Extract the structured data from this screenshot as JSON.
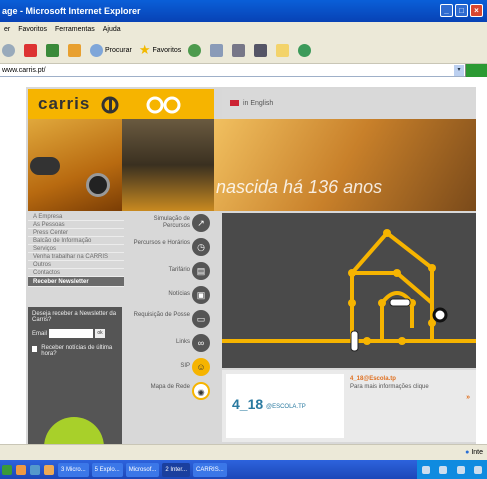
{
  "window": {
    "title": "age - Microsoft Internet Explorer"
  },
  "menubar": [
    "er",
    "Favoritos",
    "Ferramentas",
    "Ajuda"
  ],
  "toolbar": {
    "search": "Procurar",
    "favorites": "Favoritos"
  },
  "address": {
    "url": "www.carris.pt/"
  },
  "page": {
    "logo": "carris",
    "language_link": "in English",
    "tagline": "nascida há 136 anos",
    "menu": [
      "A Empresa",
      "As Pessoas",
      "Press Center",
      "Balcão de Informação",
      "Serviços",
      "Venha trabalhar na CARRIS",
      "Outros",
      "Contactos",
      "Receber Newsletter"
    ],
    "newsletter": {
      "prompt": "Deseja receber a Newsletter da Carris?",
      "email_label": "Email",
      "ok": "ok",
      "checkbox_label": "Receber notícias de última hora?"
    },
    "services": [
      {
        "label": "Simulação de Percursos",
        "icon": "route-icon"
      },
      {
        "label": "Percursos e Horários",
        "icon": "clock-icon"
      },
      {
        "label": "Tarifário",
        "icon": "ticket-icon"
      },
      {
        "label": "Notícias",
        "icon": "news-icon"
      },
      {
        "label": "Requisição de Posse",
        "icon": "bus-icon"
      },
      {
        "label": "Links",
        "icon": "link-icon"
      },
      {
        "label": "SIP",
        "icon": "sip-icon"
      },
      {
        "label": "Mapa de Rede",
        "icon": "network-map-icon"
      }
    ],
    "school": {
      "logo": "4_18",
      "logo_sub": "@ESCOLA.TP",
      "title": "4_18@Escola.tp",
      "description": "Para mais informações clique",
      "more": "»"
    }
  },
  "statusbar": {
    "zone": "Inte"
  },
  "taskbar": [
    {
      "label": "3 Micro...",
      "active": false
    },
    {
      "label": "5 Explo...",
      "active": false
    },
    {
      "label": "Microsof...",
      "active": false
    },
    {
      "label": "2 Inter...",
      "active": true
    },
    {
      "label": "CARRIS...",
      "active": false
    }
  ],
  "colors": {
    "brand": "#f6b400",
    "titlebar": "#0a5fd8"
  }
}
